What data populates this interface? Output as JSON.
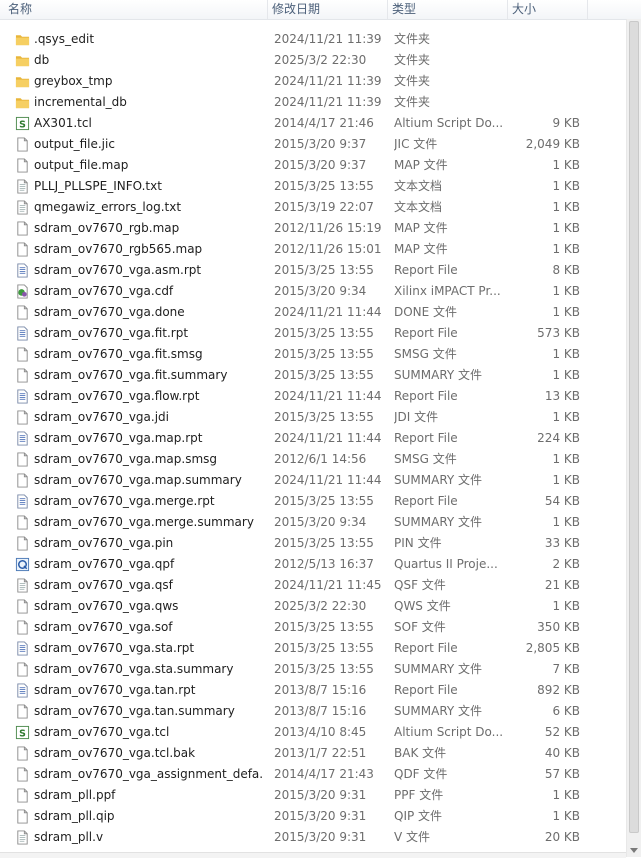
{
  "columns": {
    "name": "名称",
    "date": "修改日期",
    "type": "类型",
    "size": "大小"
  },
  "files": [
    {
      "icon": "folder",
      "name": ".qsys_edit",
      "date": "2024/11/21 11:39",
      "type": "文件夹",
      "size": ""
    },
    {
      "icon": "folder",
      "name": "db",
      "date": "2025/3/2 22:30",
      "type": "文件夹",
      "size": ""
    },
    {
      "icon": "folder",
      "name": "greybox_tmp",
      "date": "2024/11/21 11:39",
      "type": "文件夹",
      "size": ""
    },
    {
      "icon": "folder",
      "name": "incremental_db",
      "date": "2024/11/21 11:39",
      "type": "文件夹",
      "size": ""
    },
    {
      "icon": "script",
      "name": "AX301.tcl",
      "date": "2014/4/17 21:46",
      "type": "Altium Script Do...",
      "size": "9 KB"
    },
    {
      "icon": "blank",
      "name": "output_file.jic",
      "date": "2015/3/20 9:37",
      "type": "JIC 文件",
      "size": "2,049 KB"
    },
    {
      "icon": "blank",
      "name": "output_file.map",
      "date": "2015/3/20 9:37",
      "type": "MAP 文件",
      "size": "1 KB"
    },
    {
      "icon": "text",
      "name": "PLLJ_PLLSPE_INFO.txt",
      "date": "2015/3/25 13:55",
      "type": "文本文档",
      "size": "1 KB"
    },
    {
      "icon": "text",
      "name": "qmegawiz_errors_log.txt",
      "date": "2015/3/19 22:07",
      "type": "文本文档",
      "size": "1 KB"
    },
    {
      "icon": "blank",
      "name": "sdram_ov7670_rgb.map",
      "date": "2012/11/26 15:19",
      "type": "MAP 文件",
      "size": "1 KB"
    },
    {
      "icon": "blank",
      "name": "sdram_ov7670_rgb565.map",
      "date": "2012/11/26 15:01",
      "type": "MAP 文件",
      "size": "1 KB"
    },
    {
      "icon": "report",
      "name": "sdram_ov7670_vga.asm.rpt",
      "date": "2015/3/25 13:55",
      "type": "Report File",
      "size": "8 KB"
    },
    {
      "icon": "impact",
      "name": "sdram_ov7670_vga.cdf",
      "date": "2015/3/20 9:34",
      "type": "Xilinx iMPACT Pr...",
      "size": "1 KB"
    },
    {
      "icon": "blank",
      "name": "sdram_ov7670_vga.done",
      "date": "2024/11/21 11:44",
      "type": "DONE 文件",
      "size": "1 KB"
    },
    {
      "icon": "report",
      "name": "sdram_ov7670_vga.fit.rpt",
      "date": "2015/3/25 13:55",
      "type": "Report File",
      "size": "573 KB"
    },
    {
      "icon": "blank",
      "name": "sdram_ov7670_vga.fit.smsg",
      "date": "2015/3/25 13:55",
      "type": "SMSG 文件",
      "size": "1 KB"
    },
    {
      "icon": "blank",
      "name": "sdram_ov7670_vga.fit.summary",
      "date": "2015/3/25 13:55",
      "type": "SUMMARY 文件",
      "size": "1 KB"
    },
    {
      "icon": "report",
      "name": "sdram_ov7670_vga.flow.rpt",
      "date": "2024/11/21 11:44",
      "type": "Report File",
      "size": "13 KB"
    },
    {
      "icon": "blank",
      "name": "sdram_ov7670_vga.jdi",
      "date": "2015/3/25 13:55",
      "type": "JDI 文件",
      "size": "1 KB"
    },
    {
      "icon": "report",
      "name": "sdram_ov7670_vga.map.rpt",
      "date": "2024/11/21 11:44",
      "type": "Report File",
      "size": "224 KB"
    },
    {
      "icon": "blank",
      "name": "sdram_ov7670_vga.map.smsg",
      "date": "2012/6/1 14:56",
      "type": "SMSG 文件",
      "size": "1 KB"
    },
    {
      "icon": "blank",
      "name": "sdram_ov7670_vga.map.summary",
      "date": "2024/11/21 11:44",
      "type": "SUMMARY 文件",
      "size": "1 KB"
    },
    {
      "icon": "report",
      "name": "sdram_ov7670_vga.merge.rpt",
      "date": "2015/3/25 13:55",
      "type": "Report File",
      "size": "54 KB"
    },
    {
      "icon": "blank",
      "name": "sdram_ov7670_vga.merge.summary",
      "date": "2015/3/20 9:34",
      "type": "SUMMARY 文件",
      "size": "1 KB"
    },
    {
      "icon": "blank",
      "name": "sdram_ov7670_vga.pin",
      "date": "2015/3/25 13:55",
      "type": "PIN 文件",
      "size": "33 KB"
    },
    {
      "icon": "quartus",
      "name": "sdram_ov7670_vga.qpf",
      "date": "2012/5/13 16:37",
      "type": "Quartus II Proje...",
      "size": "2 KB"
    },
    {
      "icon": "text",
      "name": "sdram_ov7670_vga.qsf",
      "date": "2024/11/21 11:45",
      "type": "QSF 文件",
      "size": "21 KB"
    },
    {
      "icon": "blank",
      "name": "sdram_ov7670_vga.qws",
      "date": "2025/3/2 22:30",
      "type": "QWS 文件",
      "size": "1 KB"
    },
    {
      "icon": "blank",
      "name": "sdram_ov7670_vga.sof",
      "date": "2015/3/25 13:55",
      "type": "SOF 文件",
      "size": "350 KB"
    },
    {
      "icon": "report",
      "name": "sdram_ov7670_vga.sta.rpt",
      "date": "2015/3/25 13:55",
      "type": "Report File",
      "size": "2,805 KB"
    },
    {
      "icon": "blank",
      "name": "sdram_ov7670_vga.sta.summary",
      "date": "2015/3/25 13:55",
      "type": "SUMMARY 文件",
      "size": "7 KB"
    },
    {
      "icon": "report",
      "name": "sdram_ov7670_vga.tan.rpt",
      "date": "2013/8/7 15:16",
      "type": "Report File",
      "size": "892 KB"
    },
    {
      "icon": "blank",
      "name": "sdram_ov7670_vga.tan.summary",
      "date": "2013/8/7 15:16",
      "type": "SUMMARY 文件",
      "size": "6 KB"
    },
    {
      "icon": "script",
      "name": "sdram_ov7670_vga.tcl",
      "date": "2013/4/10 8:45",
      "type": "Altium Script Do...",
      "size": "52 KB"
    },
    {
      "icon": "blank",
      "name": "sdram_ov7670_vga.tcl.bak",
      "date": "2013/1/7 22:51",
      "type": "BAK 文件",
      "size": "40 KB"
    },
    {
      "icon": "blank",
      "name": "sdram_ov7670_vga_assignment_defa...",
      "date": "2014/4/17 21:43",
      "type": "QDF 文件",
      "size": "57 KB"
    },
    {
      "icon": "blank",
      "name": "sdram_pll.ppf",
      "date": "2015/3/20 9:31",
      "type": "PPF 文件",
      "size": "1 KB"
    },
    {
      "icon": "blank",
      "name": "sdram_pll.qip",
      "date": "2015/3/20 9:31",
      "type": "QIP 文件",
      "size": "1 KB"
    },
    {
      "icon": "text",
      "name": "sdram_pll.v",
      "date": "2015/3/20 9:31",
      "type": "V 文件",
      "size": "20 KB"
    }
  ],
  "colors": {
    "folder": "#f2c04c",
    "header_text": "#4c607a",
    "detail_text": "#6d6d6d"
  }
}
